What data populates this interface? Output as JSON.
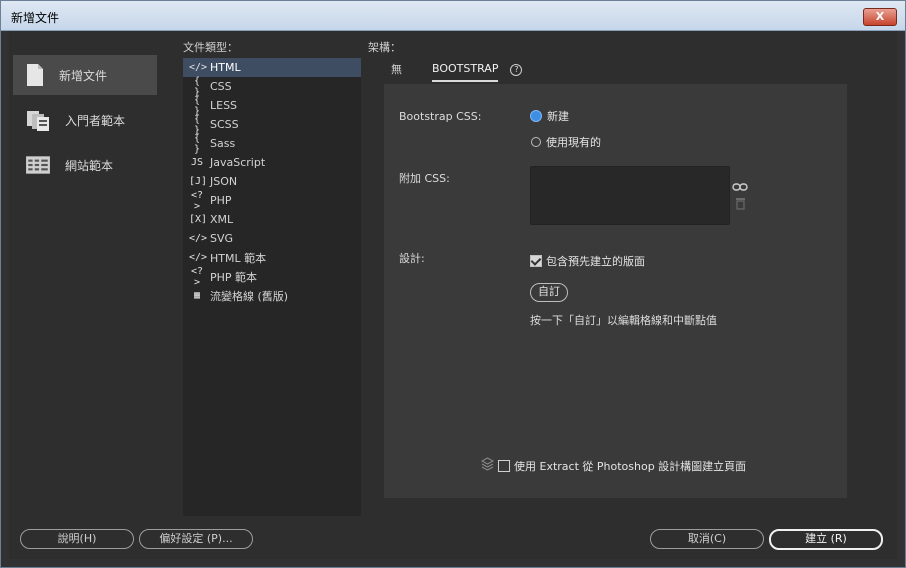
{
  "window": {
    "title": "新增文件",
    "close_label": "X"
  },
  "left_nav": [
    {
      "label": "新增文件",
      "icon": "blank-document-icon",
      "active": true
    },
    {
      "label": "入門者範本",
      "icon": "starter-templates-icon",
      "active": false
    },
    {
      "label": "網站範本",
      "icon": "site-templates-icon",
      "active": false
    }
  ],
  "doc_types": {
    "header": "文件類型：",
    "items": [
      {
        "label": "HTML",
        "icon": "</>"
      },
      {
        "label": "CSS",
        "icon": "{ }"
      },
      {
        "label": "LESS",
        "icon": "{ }"
      },
      {
        "label": "SCSS",
        "icon": "{ }"
      },
      {
        "label": "Sass",
        "icon": "{ }"
      },
      {
        "label": "JavaScript",
        "icon": "JS"
      },
      {
        "label": "JSON",
        "icon": "[J]"
      },
      {
        "label": "PHP",
        "icon": "<?>"
      },
      {
        "label": "XML",
        "icon": "[X]"
      },
      {
        "label": "SVG",
        "icon": "</>"
      },
      {
        "label": "HTML 範本",
        "icon": "</>"
      },
      {
        "label": "PHP 範本",
        "icon": "<?>"
      },
      {
        "label": "流變格線 (舊版)",
        "icon": "▦"
      }
    ]
  },
  "framework": {
    "header": "架構：",
    "tabs": [
      {
        "label": "無"
      },
      {
        "label": "BOOTSTRAP"
      }
    ],
    "help": "?"
  },
  "bootstrap": {
    "css_label": "Bootstrap CSS:",
    "new_option": "新建",
    "existing_option": "使用現有的",
    "attach_label": "附加 CSS:",
    "design_label": "設計:",
    "prebuilt_option": "包含預先建立的版面",
    "customize_button": "自訂",
    "customize_hint": "按一下「自訂」以編輯格線和中斷點值",
    "extract_option": "使用 Extract 從 Photoshop 設計構圖建立頁面"
  },
  "footer": {
    "help": "說明(H)",
    "prefs": "偏好設定 (P)...",
    "cancel": "取消(C)",
    "create": "建立 (R)"
  },
  "colors": {
    "accent": "#3d8fe6",
    "selection": "#3f4d63",
    "close": "#c7432c"
  }
}
